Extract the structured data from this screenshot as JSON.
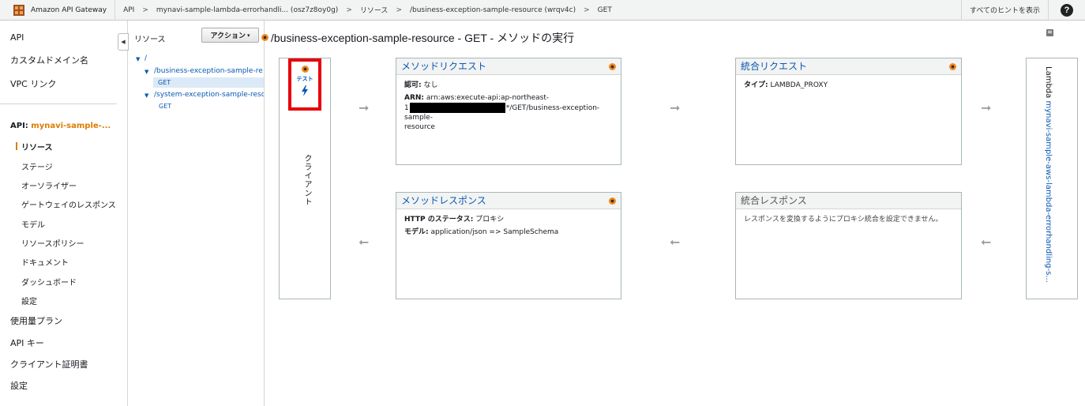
{
  "topbar": {
    "brand": "Amazon API Gateway",
    "breadcrumbs": [
      "API",
      "mynavi-sample-lambda-errorhandli... (osz7z8oy0g)",
      "リソース",
      "/business-exception-sample-resource (wrqv4c)",
      "GET"
    ],
    "separator": ">",
    "hints_label": "すべてのヒントを表示",
    "help_label": "?"
  },
  "leftnav": {
    "items_top": [
      "API",
      "カスタムドメイン名",
      "VPC リンク"
    ],
    "api_prefix": "API: ",
    "api_name": "mynavi-sample-...",
    "sub_items": [
      "リソース",
      "ステージ",
      "オーソライザー",
      "ゲートウェイのレスポンス",
      "モデル",
      "リソースポリシー",
      "ドキュメント",
      "ダッシュボード",
      "設定"
    ],
    "items_bottom": [
      "使用量プラン",
      "API キー",
      "クライアント証明書",
      "設定"
    ]
  },
  "tree": {
    "header": "リソース",
    "action_label": "アクション",
    "root": "/",
    "resources": [
      {
        "path": "/business-exception-sample-re",
        "method": "GET"
      },
      {
        "path": "/system-exception-sample-reso",
        "method": "GET"
      }
    ]
  },
  "main": {
    "title": "/business-exception-sample-resource - GET - メソッドの実行",
    "client": {
      "test_label": "テスト",
      "label": "クライアント"
    },
    "method_request": {
      "title": "メソッドリクエスト",
      "auth_label": "認可:",
      "auth_value": "なし",
      "arn_label": "ARN:",
      "arn_value_1": "arn:aws:execute-api:ap-northeast-",
      "arn_value_2a": "1",
      "arn_value_2b": "*/GET/business-exception-sample-",
      "arn_value_3": "resource"
    },
    "integration_request": {
      "title": "統合リクエスト",
      "type_label": "タイプ:",
      "type_value": "LAMBDA_PROXY"
    },
    "method_response": {
      "title": "メソッドレスポンス",
      "status_label": "HTTP のステータス:",
      "status_value": "プロキシ",
      "model_label": "モデル:",
      "model_value": "application/json => SampleSchema"
    },
    "integration_response": {
      "title": "統合レスポンス",
      "message": "レスポンスを変換するようにプロキシ統合を設定できません。"
    },
    "lambda": {
      "prefix": "Lambda ",
      "function": "mynavi-sample-aws-lambda-errorhandling-s..."
    }
  }
}
